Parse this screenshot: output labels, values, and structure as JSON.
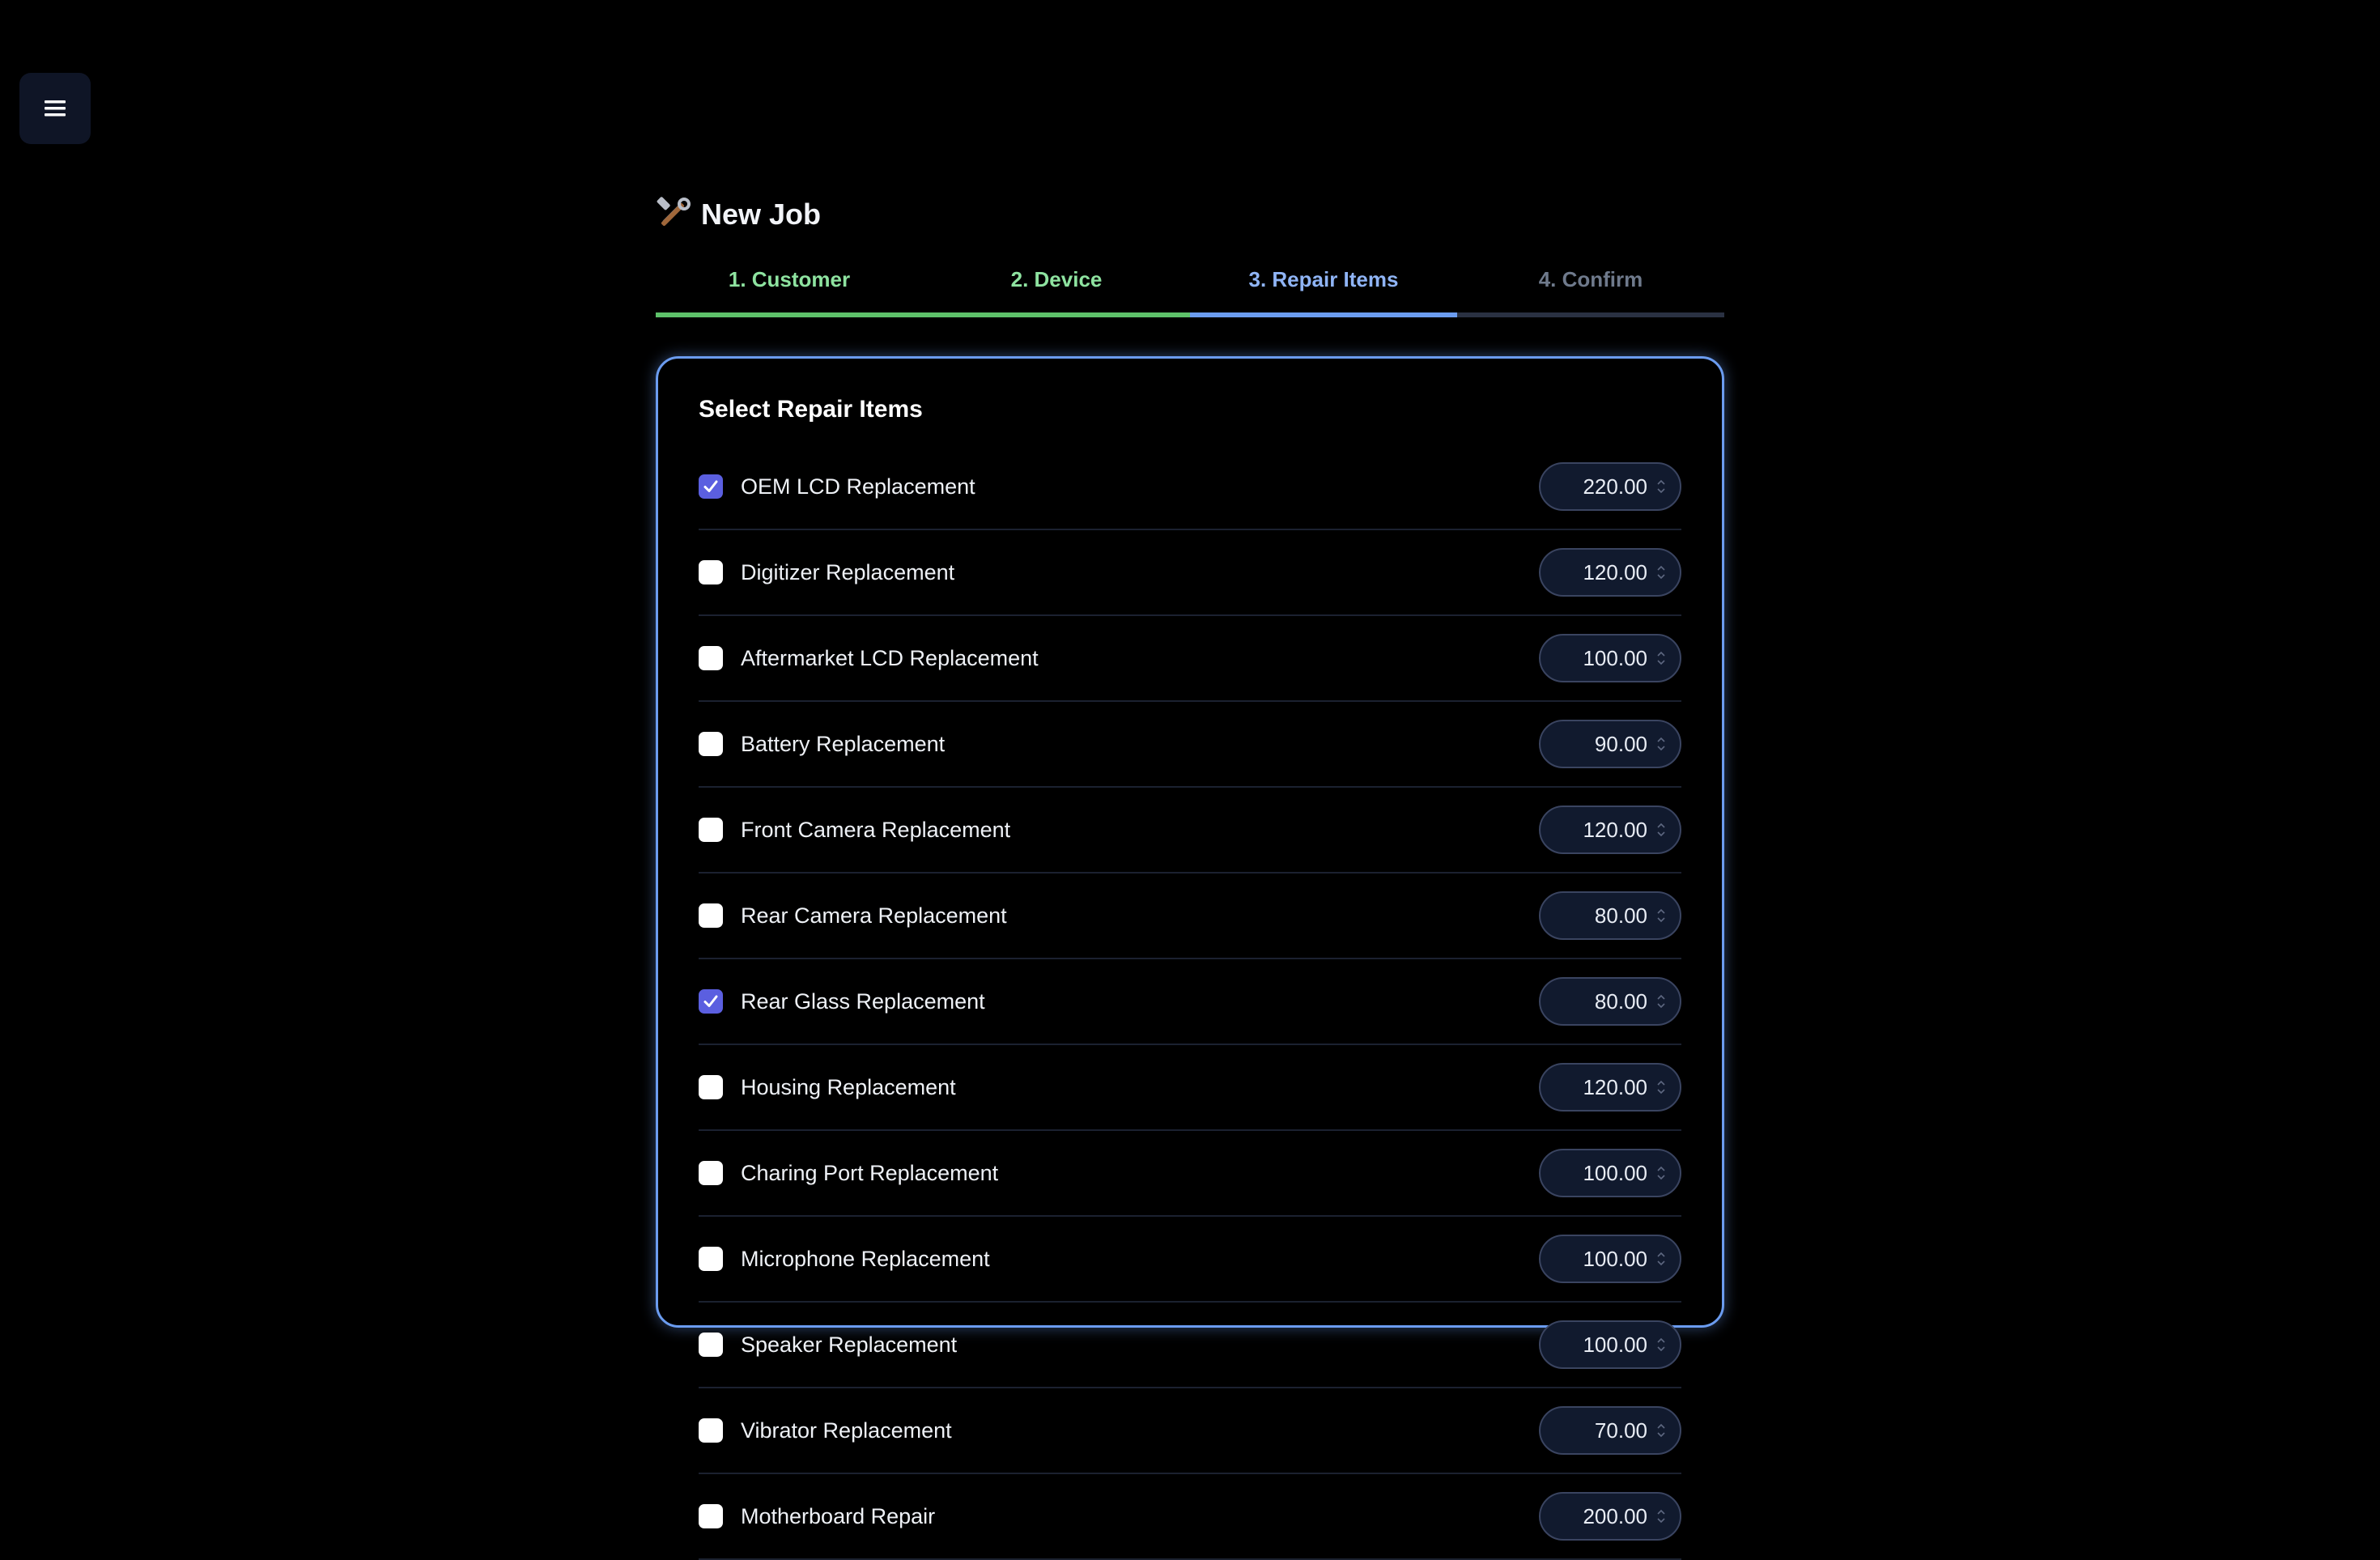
{
  "header": {
    "title": "New Job",
    "title_icon": "hammer-wrench-icon",
    "menu_icon": "hamburger-menu-icon"
  },
  "steps": [
    {
      "label": "1. Customer",
      "state": "done"
    },
    {
      "label": "2. Device",
      "state": "done"
    },
    {
      "label": "3. Repair Items",
      "state": "active"
    },
    {
      "label": "4. Confirm",
      "state": "todo"
    }
  ],
  "card": {
    "title": "Select Repair Items"
  },
  "items": [
    {
      "label": "OEM LCD Replacement",
      "price": "220.00",
      "checked": true
    },
    {
      "label": "Digitizer Replacement",
      "price": "120.00",
      "checked": false
    },
    {
      "label": "Aftermarket LCD Replacement",
      "price": "100.00",
      "checked": false
    },
    {
      "label": "Battery Replacement",
      "price": "90.00",
      "checked": false
    },
    {
      "label": "Front Camera Replacement",
      "price": "120.00",
      "checked": false
    },
    {
      "label": "Rear Camera Replacement",
      "price": "80.00",
      "checked": false
    },
    {
      "label": "Rear Glass Replacement",
      "price": "80.00",
      "checked": true
    },
    {
      "label": "Housing Replacement",
      "price": "120.00",
      "checked": false
    },
    {
      "label": "Charing Port Replacement",
      "price": "100.00",
      "checked": false
    },
    {
      "label": "Microphone Replacement",
      "price": "100.00",
      "checked": false
    },
    {
      "label": "Speaker Replacement",
      "price": "100.00",
      "checked": false
    },
    {
      "label": "Vibrator Replacement",
      "price": "70.00",
      "checked": false
    },
    {
      "label": "Motherboard Repair",
      "price": "200.00",
      "checked": false
    }
  ],
  "colors": {
    "background": "#000000",
    "accent_active": "#6b9cf0",
    "accent_done": "#5ec26a",
    "checkbox_checked": "#5b5fe0"
  }
}
